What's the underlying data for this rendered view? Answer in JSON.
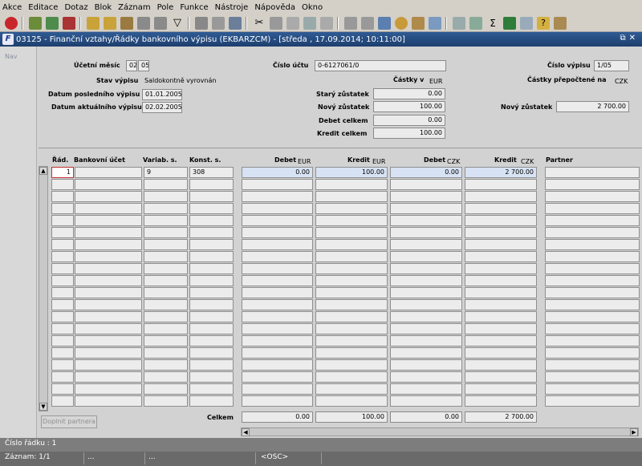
{
  "menu": [
    "Akce",
    "Editace",
    "Dotaz",
    "Blok",
    "Záznam",
    "Pole",
    "Funkce",
    "Nástroje",
    "Nápověda",
    "Okno"
  ],
  "window_title": "03125 - Finanční vztahy/Řádky bankovního výpisu (EKBARZCM) - [středa , 17.09.2014; 10:11:00]",
  "window_controls": "⧉✕",
  "nav_label": "Nav",
  "header": {
    "ucetni_mesic_label": "Účetní měsíc",
    "ucetni_mesic_1": "02",
    "ucetni_mesic_2": "05",
    "cislo_uctu_label": "Číslo účtu",
    "cislo_uctu": "0-6127061/0",
    "cislo_vypisu_label": "Číslo výpisu",
    "cislo_vypisu": "1/05",
    "stav_label": "Stav výpisu",
    "stav_value": "Saldokontně vyrovnán",
    "castky_v_label": "Částky v",
    "castky_v_currency": "EUR",
    "castky_prep_label": "Částky přepočtené na",
    "castky_prep_currency": "CZK",
    "datum_posl_label": "Datum posledního výpisu",
    "datum_posl": "01.01.2005",
    "datum_akt_label": "Datum aktuálního výpisu",
    "datum_akt": "02.02.2005",
    "stary_label": "Starý zůstatek",
    "stary": "0.00",
    "novy_label": "Nový zůstatek",
    "novy": "100.00",
    "debet_label": "Debet celkem",
    "debet": "0.00",
    "kredit_label": "Kredit celkem",
    "kredit": "100.00",
    "novy_czk_label": "Nový zůstatek",
    "novy_czk": "2 700.00"
  },
  "table": {
    "headers": {
      "rad": "Řád.",
      "ucet": "Bankovní účet",
      "var": "Variab. s.",
      "konst": "Konst. s.",
      "debet": "Debet",
      "debet_cur": "EUR",
      "kredit": "Kredit",
      "kredit_cur": "EUR",
      "debet2": "Debet",
      "debet2_cur": "CZK",
      "kredit2": "Kredit",
      "kredit2_cur": "CZK",
      "partner": "Partner"
    },
    "rows": [
      {
        "rad": "1",
        "ucet": "",
        "var": "9",
        "konst": "308",
        "debet": "0.00",
        "kredit": "100.00",
        "debet2": "0.00",
        "kredit2": "2 700.00",
        "partner": ""
      }
    ],
    "totals": {
      "label": "Celkem",
      "debet": "0.00",
      "kredit": "100.00",
      "debet2": "0.00",
      "kredit2": "2 700.00"
    }
  },
  "buttons": {
    "doplnit": "Doplnit partnera"
  },
  "status": {
    "line1": "Číslo řádku : 1",
    "zaznam": "Záznam: 1/1",
    "dots": "...",
    "osc": "<OSC>"
  }
}
